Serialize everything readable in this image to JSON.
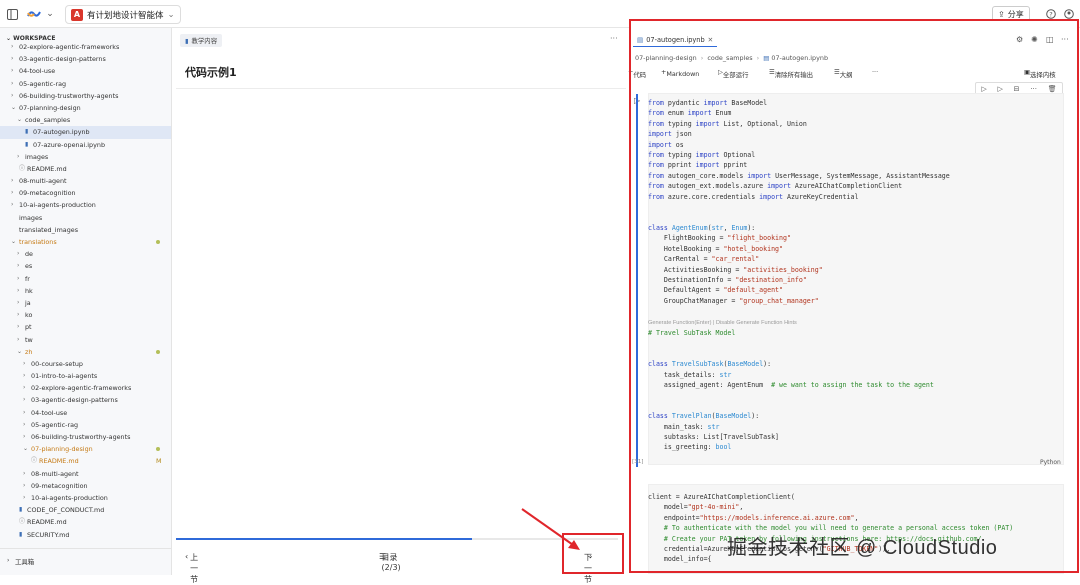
{
  "topbar": {
    "project_name": "有计划地设计智能体",
    "logo_letter": "A",
    "share_label": "分享"
  },
  "sidebar": {
    "workspace_label": "WORKSPACE",
    "items": [
      {
        "label": "02-explore-agentic-frameworks",
        "depth": 1,
        "kind": "folder"
      },
      {
        "label": "03-agentic-design-patterns",
        "depth": 1,
        "kind": "folder"
      },
      {
        "label": "04-tool-use",
        "depth": 1,
        "kind": "folder"
      },
      {
        "label": "05-agentic-rag",
        "depth": 1,
        "kind": "folder"
      },
      {
        "label": "06-building-trustworthy-agents",
        "depth": 1,
        "kind": "folder"
      },
      {
        "label": "07-planning-design",
        "depth": 1,
        "kind": "folder-open"
      },
      {
        "label": "code_samples",
        "depth": 2,
        "kind": "folder-open"
      },
      {
        "label": "07-autogen.ipynb",
        "depth": 3,
        "kind": "notebook",
        "selected": true
      },
      {
        "label": "07-azure-openai.ipynb",
        "depth": 3,
        "kind": "notebook"
      },
      {
        "label": "images",
        "depth": 2,
        "kind": "folder"
      },
      {
        "label": "README.md",
        "depth": 2,
        "kind": "info"
      },
      {
        "label": "08-multi-agent",
        "depth": 1,
        "kind": "folder"
      },
      {
        "label": "09-metacognition",
        "depth": 1,
        "kind": "folder"
      },
      {
        "label": "10-ai-agents-production",
        "depth": 1,
        "kind": "folder"
      },
      {
        "label": "images",
        "depth": 1,
        "kind": "plain"
      },
      {
        "label": "translated_images",
        "depth": 1,
        "kind": "plain"
      },
      {
        "label": "translations",
        "depth": 1,
        "kind": "folder-open",
        "orange": true,
        "dot": true
      },
      {
        "label": "de",
        "depth": 2,
        "kind": "folder"
      },
      {
        "label": "es",
        "depth": 2,
        "kind": "folder"
      },
      {
        "label": "fr",
        "depth": 2,
        "kind": "folder"
      },
      {
        "label": "hk",
        "depth": 2,
        "kind": "folder"
      },
      {
        "label": "ja",
        "depth": 2,
        "kind": "folder"
      },
      {
        "label": "ko",
        "depth": 2,
        "kind": "folder"
      },
      {
        "label": "pt",
        "depth": 2,
        "kind": "folder"
      },
      {
        "label": "tw",
        "depth": 2,
        "kind": "folder"
      },
      {
        "label": "zh",
        "depth": 2,
        "kind": "folder-open",
        "orange": true,
        "dot": true
      },
      {
        "label": "00-course-setup",
        "depth": 3,
        "kind": "folder"
      },
      {
        "label": "01-intro-to-ai-agents",
        "depth": 3,
        "kind": "folder"
      },
      {
        "label": "02-explore-agentic-frameworks",
        "depth": 3,
        "kind": "folder"
      },
      {
        "label": "03-agentic-design-patterns",
        "depth": 3,
        "kind": "folder"
      },
      {
        "label": "04-tool-use",
        "depth": 3,
        "kind": "folder"
      },
      {
        "label": "05-agentic-rag",
        "depth": 3,
        "kind": "folder"
      },
      {
        "label": "06-building-trustworthy-agents",
        "depth": 3,
        "kind": "folder"
      },
      {
        "label": "07-planning-design",
        "depth": 3,
        "kind": "folder-open",
        "orange": true,
        "dot": true
      },
      {
        "label": "README.md",
        "depth": 4,
        "kind": "info",
        "orange": true,
        "badge": "M"
      },
      {
        "label": "08-multi-agent",
        "depth": 3,
        "kind": "folder"
      },
      {
        "label": "09-metacognition",
        "depth": 3,
        "kind": "folder"
      },
      {
        "label": "10-ai-agents-production",
        "depth": 3,
        "kind": "folder"
      },
      {
        "label": "CODE_OF_CONDUCT.md",
        "depth": 2,
        "kind": "md"
      },
      {
        "label": "README.md",
        "depth": 2,
        "kind": "info"
      },
      {
        "label": "SECURITY.md",
        "depth": 2,
        "kind": "md"
      }
    ],
    "footer_label": "工具箱"
  },
  "middle": {
    "tab_label": "教学内容",
    "title": "代码示例1",
    "prev_label": "上一节",
    "toc_label": "目录(2/3)",
    "next_label": "下一节",
    "progress": 0.67
  },
  "editor": {
    "file_tab": "07-autogen.ipynb",
    "breadcrumb": [
      "07-planning-design",
      "code_samples",
      "07-autogen.ipynb"
    ],
    "toolbar": {
      "code": "代码",
      "markdown": "Markdown",
      "run_all": "全部运行",
      "clear_outputs": "清除所有输出",
      "outline": "大纲",
      "select_kernel": "选择内核"
    },
    "cell_index": "[31]",
    "language": "Python",
    "hint": "Generate Function(Enter) | Disable Generate Function Hints"
  },
  "watermark": "掘金技术社区 @ CloudStudio",
  "colors": {
    "accent": "#2f6ad9",
    "highlight_box": "#e0262b"
  }
}
